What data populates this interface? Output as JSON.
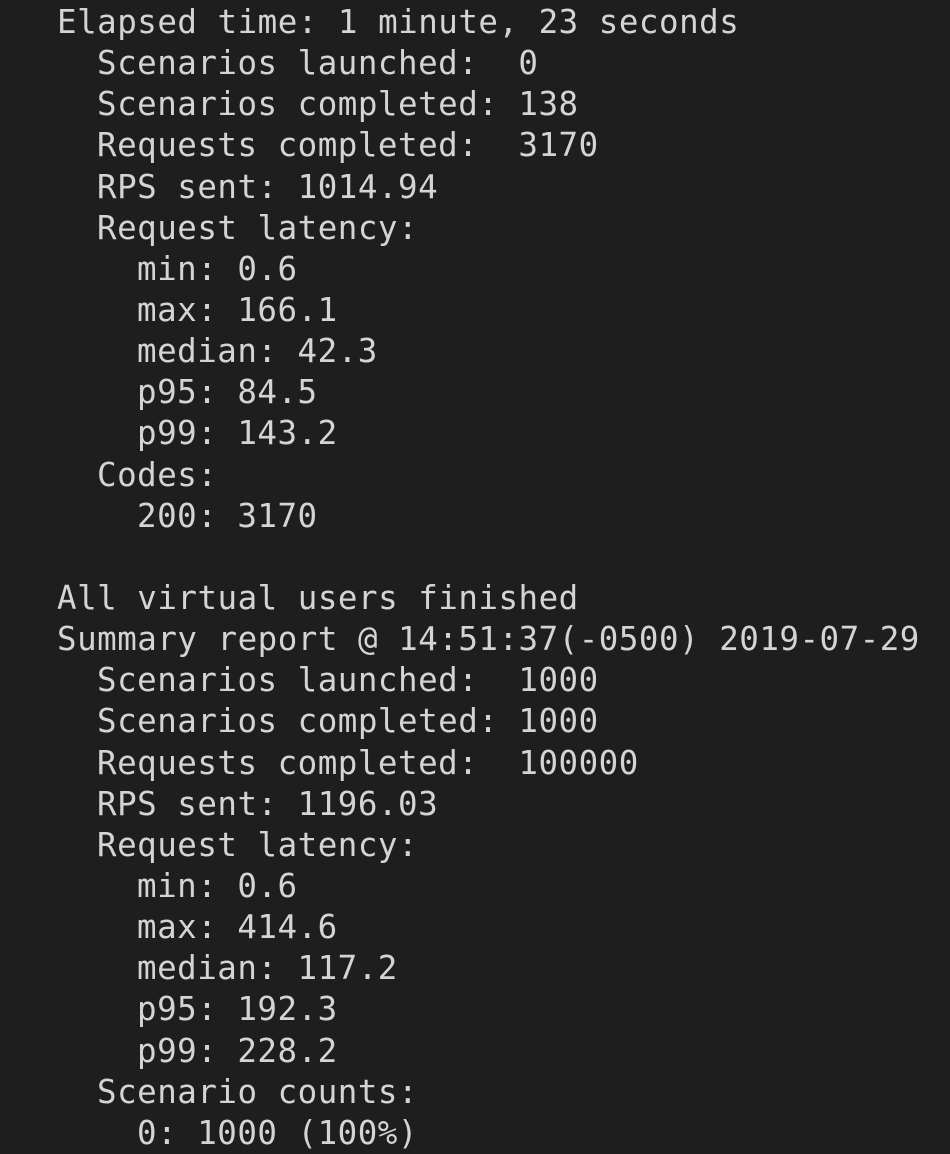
{
  "interim": {
    "elapsed": "Elapsed time: 1 minute, 23 seconds",
    "scenarios_launched": "Scenarios launched:  0",
    "scenarios_completed": "Scenarios completed: 138",
    "requests_completed": "Requests completed:  3170",
    "rps_sent": "RPS sent: 1014.94",
    "latency_header": "Request latency:",
    "latency": {
      "min": "min: 0.6",
      "max": "max: 166.1",
      "median": "median: 42.3",
      "p95": "p95: 84.5",
      "p99": "p99: 143.2"
    },
    "codes_header": "Codes:",
    "code_200": "200: 3170"
  },
  "finished": "All virtual users finished",
  "summary": {
    "title": "Summary report @ 14:51:37(-0500) 2019-07-29",
    "scenarios_launched": "Scenarios launched:  1000",
    "scenarios_completed": "Scenarios completed: 1000",
    "requests_completed": "Requests completed:  100000",
    "rps_sent": "RPS sent: 1196.03",
    "latency_header": "Request latency:",
    "latency": {
      "min": "min: 0.6",
      "max": "max: 414.6",
      "median": "median: 117.2",
      "p95": "p95: 192.3",
      "p99": "p99: 228.2"
    },
    "scenario_counts_header": "Scenario counts:",
    "scenario_count_0": "0: 1000 (100%)"
  }
}
